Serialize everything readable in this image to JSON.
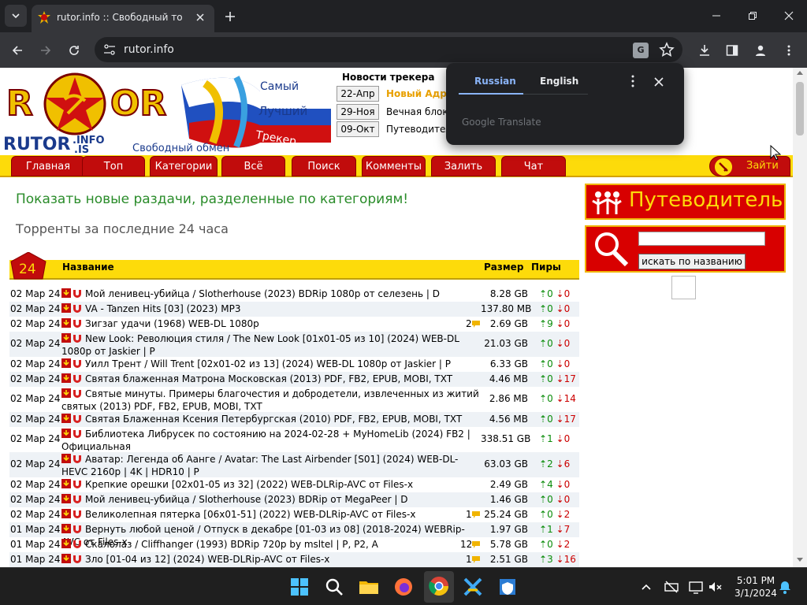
{
  "browser": {
    "tab_title": "rutor.info :: Свободный торрент трекер",
    "url": "rutor.info"
  },
  "translate_popup": {
    "source_lang": "Russian",
    "target_lang": "English",
    "brand": "Google Translate"
  },
  "site": {
    "logo": {
      "brand": "RUTOR",
      "sub": "RUTOR.INFO.IS",
      "tag1": "Самый",
      "tag2": "Лучший",
      "tag3": "Трекер",
      "slogan": "Свободный обмен"
    },
    "news_heading": "Новости трекера",
    "news": [
      {
        "date": "22-Апр",
        "text": "Новый Адрес",
        "color": "#e8a000"
      },
      {
        "date": "29-Ноя",
        "text": "Вечная блокировка",
        "color": "#000000"
      },
      {
        "date": "09-Окт",
        "text": "Путеводитель",
        "color": "#000000"
      }
    ],
    "menu": [
      "Главная",
      "Топ",
      "Категории",
      "Всё",
      "Поиск",
      "Комменты",
      "Залить",
      "Чат"
    ],
    "login": "Зайти",
    "promo": "Показать новые раздачи, разделенные по категориям!",
    "section_title": "Торренты за последние 24 часа",
    "badge": "24",
    "table_headers": {
      "name": "Название",
      "size": "Размер",
      "peers": "Пиры"
    },
    "sidebar": {
      "guide": "Путеводитель",
      "search_btn": "искать по названию",
      "search_value": ""
    }
  },
  "torrents": [
    {
      "date": "02 Мар 24",
      "name": "Мой ленивец-убийца / Slotherhouse (2023) BDRip 1080p от селезень | D",
      "comments": "",
      "size": "8.28 GB",
      "seeds": "0",
      "leech": "0"
    },
    {
      "date": "02 Мар 24",
      "name": "VA - Tanzen Hits [03] (2023) MP3",
      "comments": "",
      "size": "137.80 MB",
      "seeds": "0",
      "leech": "0"
    },
    {
      "date": "02 Мар 24",
      "name": "Зигзаг удачи (1968) WEB-DL 1080p",
      "comments": "2",
      "size": "2.69 GB",
      "seeds": "9",
      "leech": "0"
    },
    {
      "date": "02 Мар 24",
      "name": "New Look: Революция стиля / The New Look [01x01-05 из 10] (2024) WEB-DL 1080p от Jaskier | P",
      "comments": "",
      "size": "21.03 GB",
      "seeds": "0",
      "leech": "0"
    },
    {
      "date": "02 Мар 24",
      "name": "Уилл Трент / Will Trent [02x01-02 из 13] (2024) WEB-DL 1080p от Jaskier | P",
      "comments": "",
      "size": "6.33 GB",
      "seeds": "0",
      "leech": "0"
    },
    {
      "date": "02 Мар 24",
      "name": "Святая блаженная Матрона Московская (2013) PDF, FB2, EPUB, MOBI, TXT",
      "comments": "",
      "size": "4.46 MB",
      "seeds": "0",
      "leech": "17"
    },
    {
      "date": "02 Мар 24",
      "name": "Святые минуты. Примеры благочестия и добродетели, извлеченных из житий святых (2013) PDF, FB2, EPUB, MOBI, TXT",
      "comments": "",
      "size": "2.86 MB",
      "seeds": "0",
      "leech": "14"
    },
    {
      "date": "02 Мар 24",
      "name": "Святая Блаженная Ксения Петербургская (2010) PDF, FB2, EPUB, MOBI, TXT",
      "comments": "",
      "size": "4.56 MB",
      "seeds": "0",
      "leech": "17"
    },
    {
      "date": "02 Мар 24",
      "name": "Библиотека Либрусек по состоянию на 2024-02-28 + MyHomeLib (2024) FB2 | Официальная",
      "comments": "",
      "size": "338.51 GB",
      "seeds": "1",
      "leech": "0"
    },
    {
      "date": "02 Мар 24",
      "name": "Аватар: Легенда об Аанге / Avatar: The Last Airbender [S01] (2024) WEB-DL-HEVC 2160p | 4K | HDR10 | P",
      "comments": "",
      "size": "63.03 GB",
      "seeds": "2",
      "leech": "6"
    },
    {
      "date": "02 Мар 24",
      "name": "Крепкие орешки [02x01-05 из 32] (2022) WEB-DLRip-AVC от Files-x",
      "comments": "",
      "size": "2.49 GB",
      "seeds": "4",
      "leech": "0"
    },
    {
      "date": "02 Мар 24",
      "name": "Мой ленивец-убийца / Slotherhouse (2023) BDRip от MegaPeer | D",
      "comments": "",
      "size": "1.46 GB",
      "seeds": "0",
      "leech": "0"
    },
    {
      "date": "02 Мар 24",
      "name": "Великолепная пятерка [06x01-51] (2022) WEB-DLRip-AVC от Files-x",
      "comments": "1",
      "size": "25.24 GB",
      "seeds": "0",
      "leech": "2"
    },
    {
      "date": "01 Мар 24",
      "name": "Вернуть любой ценой / Отпуск в декабре [01-03 из 08] (2018-2024) WEBRip-AVC от Files-x",
      "comments": "",
      "size": "1.97 GB",
      "seeds": "1",
      "leech": "7"
    },
    {
      "date": "01 Мар 24",
      "name": "Скалолаз / Cliffhanger (1993) BDRip 720p by msltel | P, P2, A",
      "comments": "12",
      "size": "5.78 GB",
      "seeds": "0",
      "leech": "2"
    },
    {
      "date": "01 Мар 24",
      "name": "Зло [01-04 из 12] (2024) WEB-DLRip-AVC от Files-x",
      "comments": "1",
      "size": "2.51 GB",
      "seeds": "3",
      "leech": "16"
    }
  ],
  "taskbar": {
    "time": "5:01 PM",
    "date": "3/1/2024"
  }
}
